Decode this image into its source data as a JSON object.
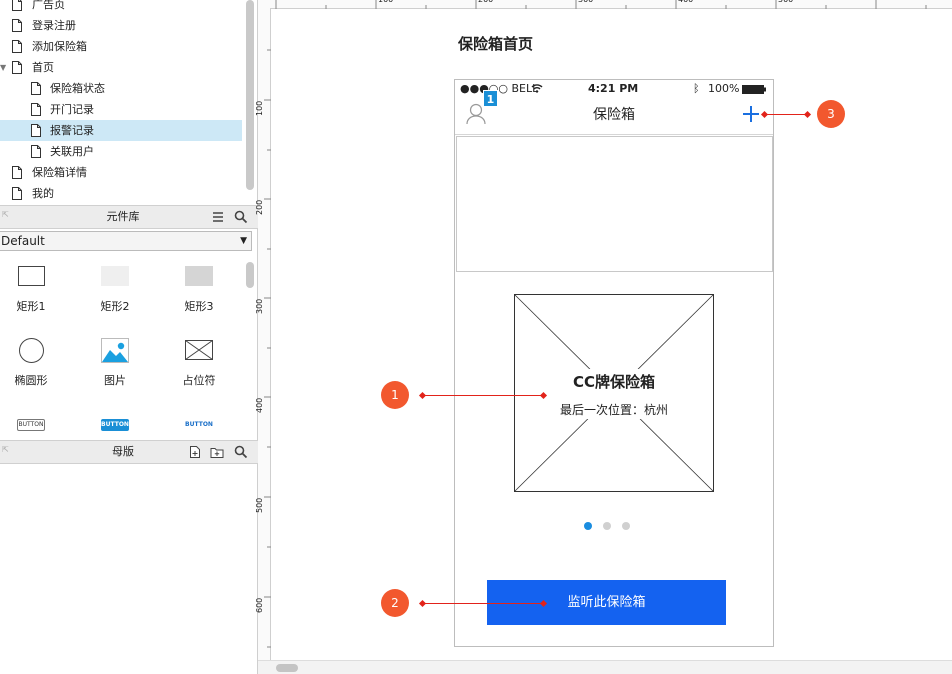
{
  "sitemap": {
    "pages": [
      {
        "label": "广告页"
      },
      {
        "label": "登录注册"
      },
      {
        "label": "添加保险箱"
      },
      {
        "label": "首页"
      },
      {
        "label": "保险箱状态"
      },
      {
        "label": "开门记录"
      },
      {
        "label": "报警记录",
        "selected": true
      },
      {
        "label": "关联用户"
      },
      {
        "label": "保险箱详情"
      },
      {
        "label": "我的"
      }
    ]
  },
  "library": {
    "title": "元件库",
    "selected_library": "Default",
    "widgets": [
      {
        "label": "矩形1",
        "icon": "rectangle-icon"
      },
      {
        "label": "矩形2",
        "icon": "light-rectangle-icon"
      },
      {
        "label": "矩形3",
        "icon": "gray-rectangle-icon"
      },
      {
        "label": "椭圆形",
        "icon": "ellipse-icon"
      },
      {
        "label": "图片",
        "icon": "image-icon"
      },
      {
        "label": "占位符",
        "icon": "placeholder-icon"
      }
    ],
    "button_widgets": [
      "BUTTON",
      "BUTTON",
      "BUTTON"
    ]
  },
  "masters": {
    "title": "母版"
  },
  "ruler": {
    "top_ticks": [
      "100",
      "200",
      "300",
      "400",
      "500"
    ],
    "left_ticks": [
      "100",
      "200",
      "300",
      "400",
      "500",
      "600"
    ]
  },
  "canvas": {
    "page_title": "保险箱首页",
    "phone": {
      "status": {
        "carrier": "●●●○○ BELL",
        "time": "4:21 PM",
        "battery": "100%"
      },
      "nav_title": "保险箱",
      "notification_badge": "1",
      "card_title": "CC牌保险箱",
      "card_subtitle": "最后一次位置：杭州",
      "carousel": {
        "count": 3,
        "active": 0
      },
      "button_label": "监听此保险箱"
    },
    "markers": [
      "1",
      "2",
      "3"
    ]
  },
  "colors": {
    "accent": "#1462f0",
    "marker": "#f2582e",
    "selected_row": "#cde8f6",
    "active_dot": "#1a8de0"
  }
}
